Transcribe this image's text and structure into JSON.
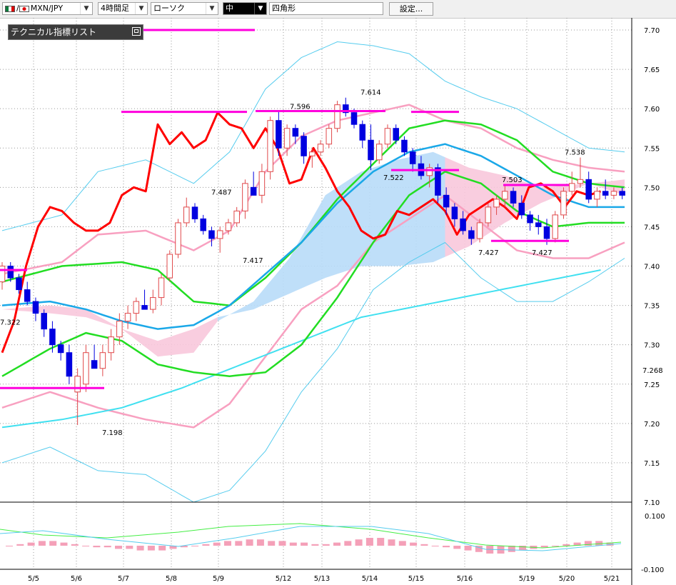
{
  "toolbar": {
    "pair": "MXN/JPY",
    "pair_separator": "/",
    "timeframe": "4時間足",
    "chart_style": "ローソク",
    "size": "中",
    "shape": "四角形",
    "settings_label": "設定..."
  },
  "indicator_list_label": "テクニカル指標リスト",
  "colors": {
    "bull_candle": "#e0484a",
    "bear_candle": "#0000e0",
    "ma_red": "#ff0000",
    "bollinger_outer": "#55ccee",
    "bollinger_inner": "#f8a0c0",
    "ma_green": "#22dd22",
    "ma_blue": "#1aa8e8",
    "ma_cyan": "#40e0f0",
    "resistance": "#ff00dd",
    "cloud_blue": "#b8dcf8",
    "cloud_pink": "#f8c8dc"
  },
  "chart_data": {
    "type": "candlestick",
    "x_labels": [
      "5/5",
      "5/6",
      "5/7",
      "5/8",
      "5/9",
      "5/12",
      "5/13",
      "5/14",
      "5/15",
      "5/16",
      "5/19",
      "5/20",
      "5/21"
    ],
    "y_ticks": [
      "7.70",
      "7.65",
      "7.60",
      "7.55",
      "7.50",
      "7.45",
      "7.40",
      "7.35",
      "7.30",
      "7.25",
      "7.20",
      "7.15",
      "7.10"
    ],
    "ylim": [
      7.1,
      7.7
    ],
    "current_price": "7.268",
    "annotations": [
      "7.322",
      "7.198",
      "7.487",
      "7.417",
      "7.596",
      "7.614",
      "7.522",
      "7.427",
      "7.503",
      "7.427",
      "7.538"
    ],
    "sub_panel_ticks": [
      "0.100",
      "-0.100"
    ],
    "candles": [
      [
        7.38,
        7.405,
        7.37,
        7.4
      ],
      [
        7.4,
        7.405,
        7.38,
        7.385
      ],
      [
        7.385,
        7.39,
        7.365,
        7.37
      ],
      [
        7.37,
        7.38,
        7.35,
        7.355
      ],
      [
        7.355,
        7.36,
        7.33,
        7.34
      ],
      [
        7.34,
        7.345,
        7.31,
        7.32
      ],
      [
        7.32,
        7.33,
        7.29,
        7.3
      ],
      [
        7.3,
        7.305,
        7.28,
        7.29
      ],
      [
        7.29,
        7.3,
        7.25,
        7.26
      ],
      [
        7.24,
        7.27,
        7.198,
        7.26
      ],
      [
        7.25,
        7.3,
        7.24,
        7.29
      ],
      [
        7.28,
        7.3,
        7.27,
        7.27
      ],
      [
        7.27,
        7.3,
        7.26,
        7.29
      ],
      [
        7.29,
        7.32,
        7.28,
        7.31
      ],
      [
        7.31,
        7.34,
        7.3,
        7.33
      ],
      [
        7.33,
        7.35,
        7.32,
        7.34
      ],
      [
        7.34,
        7.36,
        7.33,
        7.355
      ],
      [
        7.35,
        7.37,
        7.345,
        7.345
      ],
      [
        7.345,
        7.37,
        7.34,
        7.36
      ],
      [
        7.36,
        7.39,
        7.35,
        7.385
      ],
      [
        7.385,
        7.42,
        7.38,
        7.415
      ],
      [
        7.415,
        7.46,
        7.41,
        7.455
      ],
      [
        7.455,
        7.487,
        7.45,
        7.475
      ],
      [
        7.475,
        7.48,
        7.455,
        7.46
      ],
      [
        7.46,
        7.465,
        7.44,
        7.445
      ],
      [
        7.445,
        7.45,
        7.425,
        7.435
      ],
      [
        7.435,
        7.45,
        7.417,
        7.445
      ],
      [
        7.445,
        7.46,
        7.44,
        7.455
      ],
      [
        7.455,
        7.475,
        7.45,
        7.47
      ],
      [
        7.47,
        7.51,
        7.46,
        7.505
      ],
      [
        7.5,
        7.52,
        7.49,
        7.49
      ],
      [
        7.49,
        7.53,
        7.48,
        7.52
      ],
      [
        7.52,
        7.59,
        7.51,
        7.585
      ],
      [
        7.585,
        7.596,
        7.54,
        7.55
      ],
      [
        7.55,
        7.58,
        7.54,
        7.575
      ],
      [
        7.575,
        7.58,
        7.555,
        7.565
      ],
      [
        7.565,
        7.57,
        7.53,
        7.54
      ],
      [
        7.54,
        7.55,
        7.525,
        7.545
      ],
      [
        7.545,
        7.56,
        7.54,
        7.555
      ],
      [
        7.555,
        7.58,
        7.55,
        7.575
      ],
      [
        7.575,
        7.61,
        7.57,
        7.605
      ],
      [
        7.605,
        7.614,
        7.59,
        7.595
      ],
      [
        7.595,
        7.6,
        7.575,
        7.58
      ],
      [
        7.58,
        7.585,
        7.55,
        7.56
      ],
      [
        7.56,
        7.58,
        7.522,
        7.535
      ],
      [
        7.535,
        7.56,
        7.53,
        7.555
      ],
      [
        7.555,
        7.58,
        7.55,
        7.575
      ],
      [
        7.575,
        7.58,
        7.555,
        7.56
      ],
      [
        7.56,
        7.565,
        7.54,
        7.545
      ],
      [
        7.545,
        7.55,
        7.52,
        7.53
      ],
      [
        7.53,
        7.54,
        7.51,
        7.515
      ],
      [
        7.515,
        7.53,
        7.5,
        7.525
      ],
      [
        7.525,
        7.53,
        7.48,
        7.49
      ],
      [
        7.49,
        7.5,
        7.465,
        7.475
      ],
      [
        7.475,
        7.48,
        7.45,
        7.46
      ],
      [
        7.46,
        7.47,
        7.44,
        7.445
      ],
      [
        7.445,
        7.45,
        7.427,
        7.435
      ],
      [
        7.435,
        7.46,
        7.43,
        7.455
      ],
      [
        7.455,
        7.48,
        7.45,
        7.475
      ],
      [
        7.475,
        7.49,
        7.465,
        7.485
      ],
      [
        7.485,
        7.503,
        7.475,
        7.495
      ],
      [
        7.495,
        7.5,
        7.475,
        7.48
      ],
      [
        7.48,
        7.49,
        7.46,
        7.465
      ],
      [
        7.465,
        7.47,
        7.445,
        7.455
      ],
      [
        7.455,
        7.465,
        7.44,
        7.45
      ],
      [
        7.45,
        7.46,
        7.427,
        7.435
      ],
      [
        7.435,
        7.47,
        7.43,
        7.465
      ],
      [
        7.465,
        7.5,
        7.46,
        7.495
      ],
      [
        7.495,
        7.52,
        7.49,
        7.505
      ],
      [
        7.505,
        7.538,
        7.5,
        7.51
      ],
      [
        7.51,
        7.52,
        7.48,
        7.485
      ],
      [
        7.485,
        7.5,
        7.475,
        7.495
      ],
      [
        7.495,
        7.51,
        7.485,
        7.49
      ],
      [
        7.49,
        7.5,
        7.485,
        7.495
      ],
      [
        7.495,
        7.5,
        7.485,
        7.49
      ]
    ],
    "ma_red": [
      7.29,
      7.33,
      7.4,
      7.45,
      7.475,
      7.47,
      7.455,
      7.445,
      7.445,
      7.455,
      7.49,
      7.5,
      7.495,
      7.58,
      7.555,
      7.57,
      7.55,
      7.56,
      7.595,
      7.58,
      7.575,
      7.55,
      7.575,
      7.55,
      7.505,
      7.51,
      7.55,
      7.525,
      7.495,
      7.475,
      7.445,
      7.435,
      7.44,
      7.47,
      7.465,
      7.475,
      7.485,
      7.47,
      7.44,
      7.465,
      7.475,
      7.485,
      7.475,
      7.46,
      7.5,
      7.505,
      7.495,
      7.475,
      7.495,
      7.49,
      7.495
    ],
    "bands": {
      "ma_blue": [
        [
          0,
          7.35
        ],
        [
          8,
          7.355
        ],
        [
          14,
          7.345
        ],
        [
          20,
          7.33
        ],
        [
          26,
          7.32
        ],
        [
          32,
          7.325
        ],
        [
          38,
          7.35
        ],
        [
          44,
          7.39
        ],
        [
          50,
          7.43
        ],
        [
          56,
          7.48
        ],
        [
          62,
          7.52
        ],
        [
          68,
          7.545
        ],
        [
          74,
          7.555
        ],
        [
          80,
          7.54
        ],
        [
          86,
          7.515
        ],
        [
          92,
          7.49
        ],
        [
          98,
          7.475
        ],
        [
          104,
          7.475
        ]
      ],
      "ma_green_fast": [
        [
          0,
          7.38
        ],
        [
          10,
          7.4
        ],
        [
          20,
          7.405
        ],
        [
          26,
          7.395
        ],
        [
          32,
          7.355
        ],
        [
          38,
          7.35
        ],
        [
          44,
          7.385
        ],
        [
          50,
          7.43
        ],
        [
          56,
          7.485
        ],
        [
          62,
          7.53
        ],
        [
          68,
          7.575
        ],
        [
          74,
          7.585
        ],
        [
          80,
          7.58
        ],
        [
          86,
          7.56
        ],
        [
          92,
          7.52
        ],
        [
          98,
          7.505
        ],
        [
          104,
          7.5
        ]
      ],
      "ma_green_slow": [
        [
          0,
          7.26
        ],
        [
          8,
          7.295
        ],
        [
          14,
          7.315
        ],
        [
          20,
          7.305
        ],
        [
          26,
          7.275
        ],
        [
          32,
          7.265
        ],
        [
          38,
          7.26
        ],
        [
          44,
          7.265
        ],
        [
          50,
          7.3
        ],
        [
          56,
          7.36
        ],
        [
          62,
          7.43
        ],
        [
          68,
          7.49
        ],
        [
          74,
          7.52
        ],
        [
          80,
          7.505
        ],
        [
          86,
          7.47
        ],
        [
          92,
          7.45
        ],
        [
          98,
          7.455
        ],
        [
          104,
          7.455
        ]
      ],
      "ma_cyan": [
        [
          0,
          7.195
        ],
        [
          10,
          7.205
        ],
        [
          20,
          7.22
        ],
        [
          30,
          7.245
        ],
        [
          40,
          7.275
        ],
        [
          50,
          7.305
        ],
        [
          60,
          7.335
        ],
        [
          70,
          7.35
        ],
        [
          80,
          7.365
        ],
        [
          90,
          7.38
        ],
        [
          100,
          7.395
        ]
      ],
      "bb_inner_upper": [
        [
          0,
          7.39
        ],
        [
          10,
          7.405
        ],
        [
          16,
          7.44
        ],
        [
          24,
          7.445
        ],
        [
          32,
          7.42
        ],
        [
          38,
          7.445
        ],
        [
          44,
          7.52
        ],
        [
          50,
          7.565
        ],
        [
          56,
          7.585
        ],
        [
          62,
          7.595
        ],
        [
          68,
          7.605
        ],
        [
          74,
          7.585
        ],
        [
          80,
          7.575
        ],
        [
          86,
          7.55
        ],
        [
          92,
          7.535
        ],
        [
          98,
          7.525
        ],
        [
          104,
          7.52
        ]
      ],
      "bb_inner_lower": [
        [
          0,
          7.22
        ],
        [
          8,
          7.24
        ],
        [
          16,
          7.22
        ],
        [
          24,
          7.205
        ],
        [
          32,
          7.195
        ],
        [
          38,
          7.225
        ],
        [
          44,
          7.285
        ],
        [
          50,
          7.345
        ],
        [
          56,
          7.375
        ],
        [
          62,
          7.43
        ],
        [
          68,
          7.46
        ],
        [
          74,
          7.49
        ],
        [
          80,
          7.455
        ],
        [
          86,
          7.42
        ],
        [
          92,
          7.41
        ],
        [
          98,
          7.41
        ],
        [
          104,
          7.43
        ]
      ],
      "bb_outer_upper": [
        [
          0,
          7.445
        ],
        [
          10,
          7.465
        ],
        [
          16,
          7.52
        ],
        [
          24,
          7.535
        ],
        [
          32,
          7.505
        ],
        [
          38,
          7.545
        ],
        [
          44,
          7.625
        ],
        [
          50,
          7.665
        ],
        [
          56,
          7.685
        ],
        [
          62,
          7.68
        ],
        [
          68,
          7.67
        ],
        [
          74,
          7.635
        ],
        [
          80,
          7.615
        ],
        [
          86,
          7.6
        ],
        [
          92,
          7.575
        ],
        [
          98,
          7.55
        ],
        [
          104,
          7.545
        ]
      ],
      "bb_outer_lower": [
        [
          0,
          7.15
        ],
        [
          8,
          7.17
        ],
        [
          16,
          7.14
        ],
        [
          24,
          7.135
        ],
        [
          32,
          7.1
        ],
        [
          38,
          7.115
        ],
        [
          44,
          7.165
        ],
        [
          50,
          7.24
        ],
        [
          56,
          7.295
        ],
        [
          62,
          7.37
        ],
        [
          68,
          7.405
        ],
        [
          74,
          7.43
        ],
        [
          80,
          7.385
        ],
        [
          86,
          7.355
        ],
        [
          92,
          7.355
        ],
        [
          98,
          7.38
        ],
        [
          104,
          7.41
        ]
      ]
    }
  }
}
